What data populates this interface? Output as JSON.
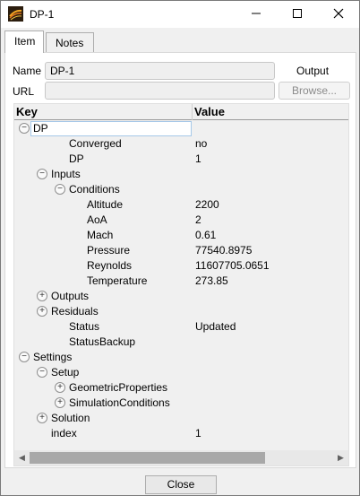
{
  "window": {
    "title": "DP-1",
    "minimize_icon": "minimize-icon",
    "maximize_icon": "maximize-icon",
    "close_icon": "close-icon"
  },
  "tabs": [
    {
      "label": "Item",
      "active": true
    },
    {
      "label": "Notes",
      "active": false
    }
  ],
  "form": {
    "name_label": "Name",
    "name_value": "DP-1",
    "output_label": "Output",
    "url_label": "URL",
    "url_value": "",
    "browse_label": "Browse..."
  },
  "tree": {
    "header": {
      "key": "Key",
      "value": "Value"
    },
    "rows": [
      {
        "key": "DP",
        "value": "",
        "toggle": "−"
      },
      {
        "key": "Converged",
        "value": "no",
        "toggle": ""
      },
      {
        "key": "DP",
        "value": "1",
        "toggle": ""
      },
      {
        "key": "Inputs",
        "value": "",
        "toggle": "−"
      },
      {
        "key": "Conditions",
        "value": "",
        "toggle": "−"
      },
      {
        "key": "Altitude",
        "value": "2200",
        "toggle": ""
      },
      {
        "key": "AoA",
        "value": "2",
        "toggle": ""
      },
      {
        "key": "Mach",
        "value": "0.61",
        "toggle": ""
      },
      {
        "key": "Pressure",
        "value": "77540.8975",
        "toggle": ""
      },
      {
        "key": "Reynolds",
        "value": "11607705.0651",
        "toggle": ""
      },
      {
        "key": "Temperature",
        "value": "273.85",
        "toggle": ""
      },
      {
        "key": "Outputs",
        "value": "",
        "toggle": "+"
      },
      {
        "key": "Residuals",
        "value": "",
        "toggle": "+"
      },
      {
        "key": "Status",
        "value": "Updated",
        "toggle": ""
      },
      {
        "key": "StatusBackup",
        "value": "",
        "toggle": ""
      },
      {
        "key": "Settings",
        "value": "",
        "toggle": "−"
      },
      {
        "key": "Setup",
        "value": "",
        "toggle": "−"
      },
      {
        "key": "GeometricProperties",
        "value": "",
        "toggle": "+"
      },
      {
        "key": "SimulationConditions",
        "value": "",
        "toggle": "+"
      },
      {
        "key": "Solution",
        "value": "",
        "toggle": "+"
      },
      {
        "key": "index",
        "value": "1",
        "toggle": ""
      }
    ]
  },
  "footer": {
    "close_label": "Close"
  },
  "colors": {
    "accent": "#a6c8e8",
    "scroll_thumb": "#a8a8a8",
    "panel_bg": "#f0f0f0"
  }
}
